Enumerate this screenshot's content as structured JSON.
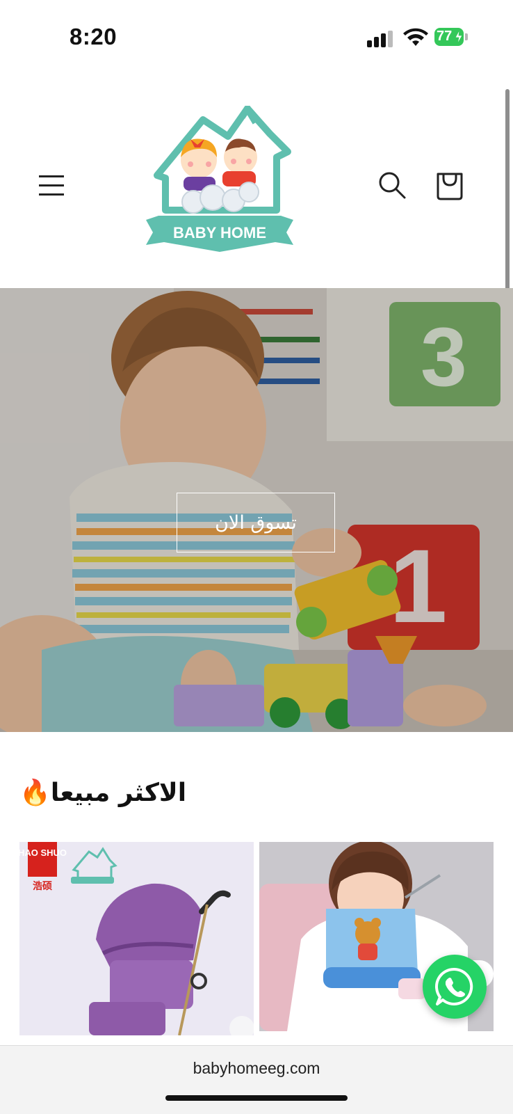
{
  "status_bar": {
    "time": "8:20",
    "battery": "77"
  },
  "header": {
    "logo_text": "BABY HOME",
    "menu_icon": "hamburger-menu-icon",
    "search_icon": "search-icon",
    "cart_icon": "shopping-bag-icon"
  },
  "hero": {
    "button_label": "تسوق الان"
  },
  "best_sellers": {
    "title": "الاكثر مبيعا",
    "title_emoji": "🔥",
    "products": [
      {
        "brand_text": "HAO SHUO",
        "brand_cn": "浩硕"
      },
      {}
    ]
  },
  "browser": {
    "url": "babyhomeeg.com"
  },
  "colors": {
    "accent_teal": "#5fbfae",
    "whatsapp": "#25d366",
    "battery": "#34c759"
  }
}
